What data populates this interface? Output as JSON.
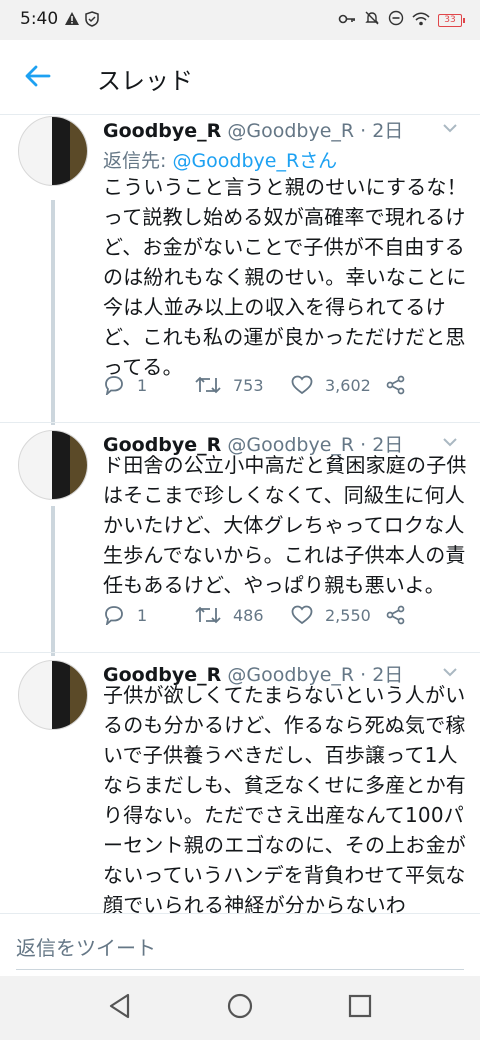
{
  "status_bar": {
    "time": "5:40",
    "battery": "33",
    "icons": [
      "alert-icon",
      "vpn-shield-icon",
      "key-icon",
      "mute-icon",
      "do-not-disturb-icon",
      "wifi-icon",
      "battery-icon"
    ]
  },
  "header": {
    "back_icon": "arrow-left-icon",
    "title": "スレッド"
  },
  "tweets": [
    {
      "name": "Goodbye_R",
      "handle": "@Goodbye_R",
      "sep": " · ",
      "time": "2日",
      "reply_to_label": "返信先: ",
      "reply_to_user": "@Goodbye_Rさん",
      "text_lines": [
        "こういうこと言うと親のせいにするな！",
        "って説教し始める奴が高確率で現れるけ",
        "ど、お金がないことで子供が不自由する",
        "のは紛れもなく親のせい。幸いなことに",
        "今は人並み以上の収入を得られてるけ",
        "ど、これも私の運が良かっただけだと思",
        "ってる。"
      ],
      "replies": "1",
      "retweets": "753",
      "likes": "3,602"
    },
    {
      "name": "Goodbye_R",
      "handle": "@Goodbye_R",
      "sep": " · ",
      "time": "2日",
      "text_lines": [
        "ド田舎の公立小中高だと貧困家庭の子供",
        "はそこまで珍しくなくて、同級生に何人",
        "かいたけど、大体グレちゃってロクな人",
        "生歩んでないから。これは子供本人の責",
        "任もあるけど、やっぱり親も悪いよ。"
      ],
      "replies": "1",
      "retweets": "486",
      "likes": "2,550"
    },
    {
      "name": "Goodbye_R",
      "handle": "@Goodbye_R",
      "sep": " · ",
      "time": "2日",
      "text_lines": [
        "子供が欲しくてたまらないという人がい",
        "るのも分かるけど、作るなら死ぬ気で稼",
        "いで子供養うべきだし、百歩譲って1人",
        "ならまだしも、貧乏なくせに多産とか有",
        "り得ない。ただでさえ出産なんて100パ",
        "ーセント親のエゴなのに、その上お金が",
        "ないっていうハンデを背負わせて平気な",
        "顔でいられる神経が分からないわ"
      ]
    }
  ],
  "reply_bar": {
    "placeholder": "返信をツイート"
  },
  "nav": {
    "icons": [
      "back-triangle-icon",
      "home-circle-icon",
      "recents-square-icon"
    ]
  },
  "colors": {
    "accent": "#1da1f2",
    "text": "#14171a",
    "secondary": "#657786",
    "thread_line": "#ccd6dd"
  }
}
